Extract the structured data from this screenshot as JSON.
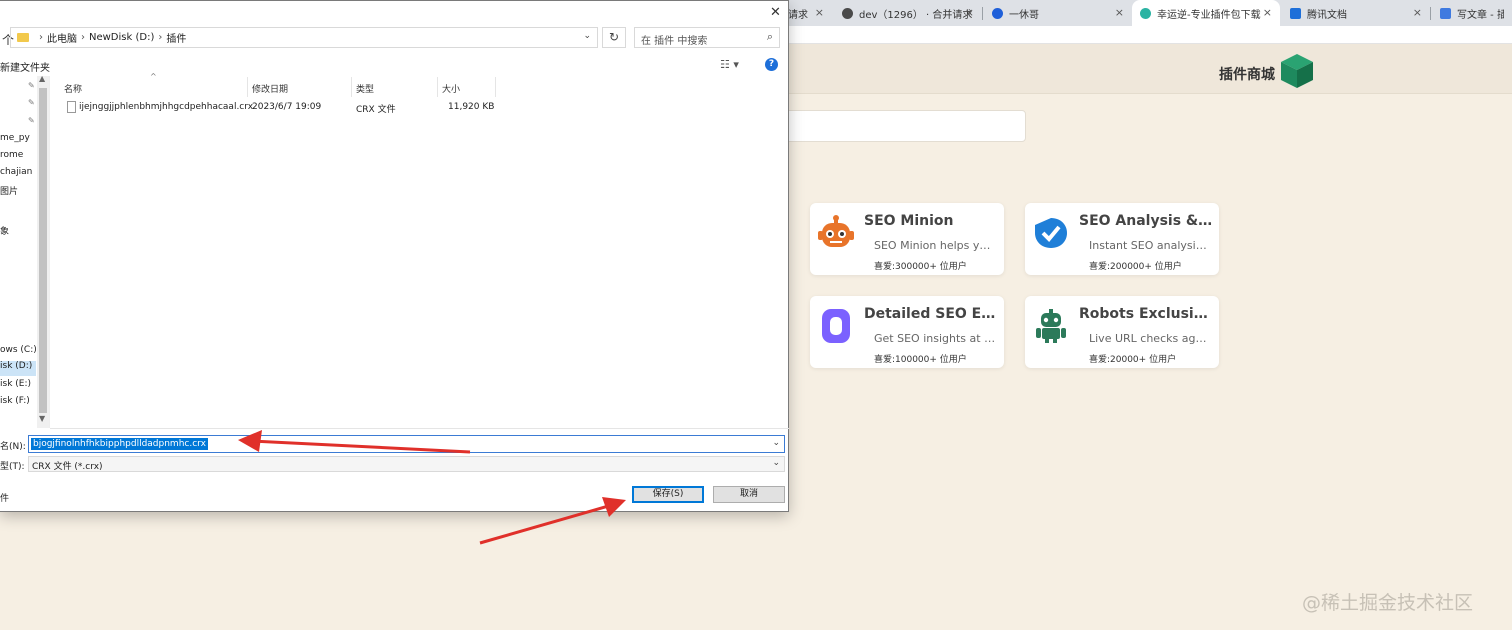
{
  "browser": {
    "tabs": [
      {
        "label": "请求",
        "favicon_color": "#ffffff"
      },
      {
        "label": "dev（1296） · 合并请求 ·",
        "favicon_color": "#4a4a4a"
      },
      {
        "label": "一休哥",
        "favicon_color": "#1e5fd9"
      },
      {
        "label": "幸运逆-专业插件包下载",
        "favicon_color": "#2bb3a3",
        "active": true
      },
      {
        "label": "腾讯文档",
        "favicon_color": "#1e6fd9"
      },
      {
        "label": "写文章 - 插件包",
        "favicon_color": "#3f7ae0"
      }
    ],
    "tab_close": "×"
  },
  "store": {
    "title": "插件商城",
    "logo_color": "#1e8a5e",
    "cards": [
      {
        "title": "SEO Minion",
        "desc": "SEO Minion helps you with your...",
        "users": "喜爱:300000+ 位用户",
        "icon": "robot-orange-icon",
        "color": "#e8742a"
      },
      {
        "title": "SEO Analysis & Website Review",
        "desc": "Instant SEO analysis and...",
        "users": "喜爱:200000+ 位用户",
        "icon": "checkmark-badge-icon",
        "color": "#1f7fd8"
      },
      {
        "title": "Detailed SEO Extension",
        "desc": "Get SEO insights at one click...",
        "users": "喜爱:100000+ 位用户",
        "icon": "purple-o-icon",
        "color": "#7b61ff"
      },
      {
        "title": "Robots Exclusion Checker",
        "desc": "Live URL checks against...",
        "users": "喜爱:20000+ 位用户",
        "icon": "android-robot-icon",
        "color": "#2c7a5a"
      }
    ]
  },
  "watermark": "@稀土掘金技术社区",
  "dialog": {
    "close": "✕",
    "up_arrow": "个",
    "path": [
      "此电脑",
      "NewDisk (D:)",
      "插件"
    ],
    "path_sep": "›",
    "dropdown_glyph": "⌄",
    "refresh_glyph": "↻",
    "search_placeholder": "在 插件 中搜索",
    "search_glyph": "⌕",
    "new_folder": "新建文件夹",
    "view_glyph": "☷ ▾",
    "help_glyph": "?",
    "nav_items": [
      "me_py",
      "rome",
      "chajian",
      "图片",
      "象",
      "ows (C:)",
      "isk (D:)",
      "isk (E:)",
      "isk (F:)"
    ],
    "pin_glyph": "📌",
    "scroll_up": "▲",
    "scroll_down": "▼",
    "columns": {
      "name": "名称",
      "date": "修改日期",
      "type": "类型",
      "size": "大小"
    },
    "sort_glyph": "^",
    "file": {
      "name": "ijejnggjjphlenbhmjhhgcdpehhacaal.crx",
      "date": "2023/6/7 19:09",
      "type": "CRX 文件",
      "size": "11,920 KB"
    },
    "filename_label": "名(N):",
    "filename_value": "bjogjfinolnhfhkbipphpdlldadpnmhc.crx",
    "filetype_label": "型(T):",
    "filetype_value": "CRX 文件 (*.crx)",
    "bottom_label": "件",
    "save_button": "保存(S)",
    "cancel_button": "取消"
  },
  "annotation_color": "#e0302a"
}
